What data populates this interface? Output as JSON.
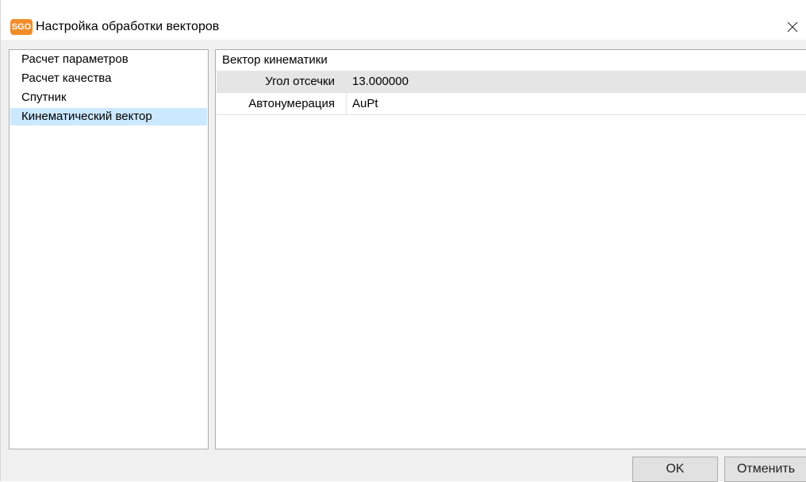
{
  "window": {
    "title": "Настройка обработки векторов",
    "app_icon_text": "SGO",
    "close_icon": "close-icon"
  },
  "sidebar": {
    "items": [
      {
        "label": "Расчет параметров"
      },
      {
        "label": "Расчет качества"
      },
      {
        "label": "Спутник"
      },
      {
        "label": "Кинематический вектор"
      }
    ],
    "selected_index": 3
  },
  "properties": {
    "section_title": "Вектор кинематики",
    "rows": [
      {
        "name": "Угол отсечки",
        "value": "13.000000"
      },
      {
        "name": "Автонумерация",
        "value": "AuPt"
      }
    ]
  },
  "buttons": {
    "ok_label": "OK",
    "cancel_label": "Отменить"
  },
  "colors": {
    "selection": "#cce8ff",
    "row_selected": "#e5e5e5",
    "app_icon": "#f28c28"
  }
}
